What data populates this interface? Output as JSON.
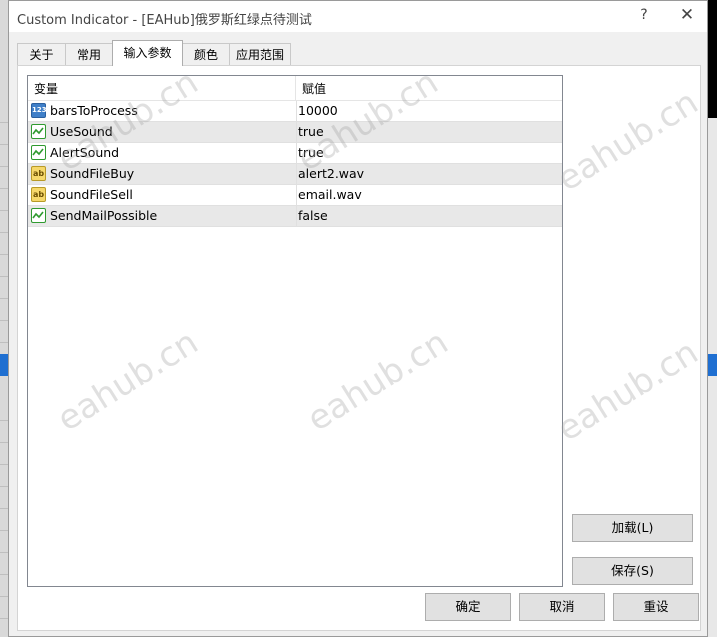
{
  "window": {
    "title": "Custom Indicator - [EAHub]俄罗斯红绿点待测试",
    "help_label": "?",
    "close_label": "✕"
  },
  "tabs": [
    {
      "label": "关于",
      "active": false
    },
    {
      "label": "常用",
      "active": false
    },
    {
      "label": "输入参数",
      "active": true
    },
    {
      "label": "颜色",
      "active": false
    },
    {
      "label": "应用范围",
      "active": false
    }
  ],
  "table": {
    "headers": {
      "variable": "变量",
      "value": "赋值"
    },
    "rows": [
      {
        "name": "barsToProcess",
        "value": "10000",
        "icon": "integer-icon",
        "icon_text": "123"
      },
      {
        "name": "UseSound",
        "value": "true",
        "icon": "boolean-icon",
        "icon_text": ""
      },
      {
        "name": "AlertSound",
        "value": "true",
        "icon": "boolean-icon",
        "icon_text": ""
      },
      {
        "name": "SoundFileBuy",
        "value": "alert2.wav",
        "icon": "string-icon",
        "icon_text": "ab"
      },
      {
        "name": "SoundFileSell",
        "value": "email.wav",
        "icon": "string-icon",
        "icon_text": "ab"
      },
      {
        "name": "SendMailPossible",
        "value": "false",
        "icon": "boolean-icon",
        "icon_text": ""
      }
    ]
  },
  "buttons": {
    "load": "加载(L)",
    "save": "保存(S)",
    "ok": "确定",
    "cancel": "取消",
    "reset": "重设"
  },
  "watermark": "eahub.cn"
}
